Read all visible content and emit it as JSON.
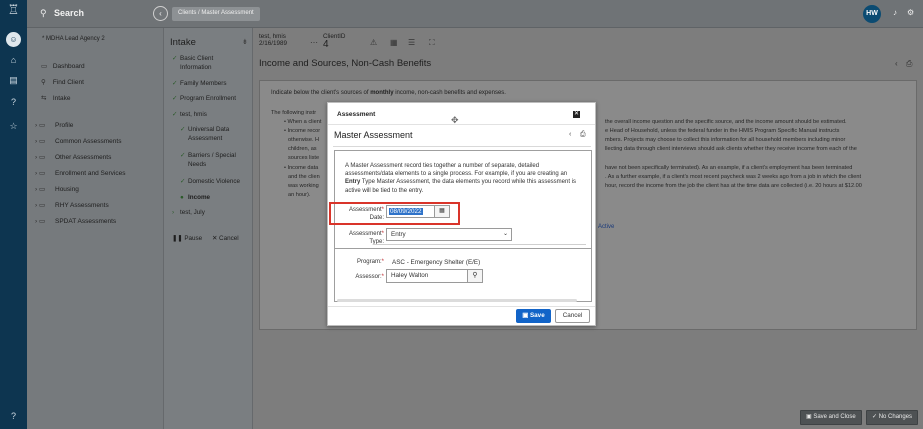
{
  "rail": {
    "logo": "♖",
    "avatar": "☺",
    "icons": [
      "⌂",
      "▤",
      "?",
      "☆"
    ],
    "help": "?"
  },
  "topbar": {
    "search_label": "Search",
    "breadcrumb": "Clients / Master Assessment",
    "user_initials": "HW",
    "bell": "🔔",
    "gear": "⚙"
  },
  "sidebar": {
    "agency": "* MDHA Lead Agency 2",
    "nav": [
      {
        "icon": "▭",
        "label": "Dashboard"
      },
      {
        "icon": "⚲",
        "label": "Find Client"
      },
      {
        "icon": "⇆",
        "label": "Intake"
      }
    ],
    "folders": [
      "Profile",
      "Common Assessments",
      "Other Assessments",
      "Enrollment and Services",
      "Housing",
      "RHY Assessments",
      "SPDAT Assessments"
    ]
  },
  "intake": {
    "title": "Intake",
    "steps": [
      {
        "label": "Basic Client",
        "label2": "Information",
        "check": "✓",
        "sub": false
      },
      {
        "label": "Family Members",
        "label2": "",
        "check": "✓",
        "sub": false
      },
      {
        "label": "Program Enrollment",
        "label2": "",
        "check": "✓",
        "sub": false
      },
      {
        "label": "test, hmis",
        "label2": "",
        "check": "✓",
        "sub": false
      },
      {
        "label": "Universal Data",
        "label2": "Assessment",
        "check": "✓",
        "sub": true
      },
      {
        "label": "Barriers / Special",
        "label2": "Needs",
        "check": "✓",
        "sub": true
      },
      {
        "label": "Domestic Violence",
        "label2": "",
        "check": "✓",
        "sub": true
      },
      {
        "label": "Income",
        "label2": "",
        "check": "●",
        "sub": true
      },
      {
        "label": "test, July",
        "label2": "",
        "check": "›",
        "sub": false
      }
    ],
    "pause": "Pause",
    "cancel": "Cancel"
  },
  "client": {
    "name": "test, hmis",
    "dob": "2/16/1989",
    "id_label": "ClientID",
    "id": "4"
  },
  "main": {
    "title": "Income and Sources, Non-Cash Benefits",
    "intro_pre": "Indicate below the client's sources of ",
    "intro_bold": "monthly",
    "intro_post": " income, non-cash benefits and expenses.",
    "bg_lines": [
      "The following instr",
      "• When a client",
      "• Income recor",
      "otherwise. H",
      "children, as",
      "sources liste",
      "• Income data",
      "and the clien",
      "was working",
      "an hour).",
      "the overall income question and the specific source, and the income amount should be estimated.",
      "e Head of Household, unless the federal funder in the HMIS Program Specific Manual instructs",
      "mbers. Projects may choose to collect this information for all household members including minor",
      "llecting data through client interviews should ask clients whether they receive income from each of the",
      "have not been specifically terminated). As an example, if a client's employment has been terminated",
      ". As a further example, if a client's most recent paycheck was 2 weeks ago from a job in which the client",
      "hour, record the income from the job the client has at the time data are collected (i.e. 20 hours at $12.00"
    ],
    "active": "Active",
    "save_close": "Save and Close",
    "no_changes": "No Changes"
  },
  "modal": {
    "header": "Assessment",
    "title": "Master Assessment",
    "desc_1": "A Master Assessment record ties together a number of separate, detailed assessments/data elements to a single process. For example, if you are creating an ",
    "desc_bold": "Entry",
    "desc_2": " Type Master Assessment, the data elements you record while this assessment is active will be tied to the entry.",
    "date_label_1": "Assessment",
    "date_label_2": "Date:",
    "date_value": "08/09/2022",
    "type_label_1": "Assessment",
    "type_label_2": "Type:",
    "type_value": "Entry",
    "program_label": "Program:",
    "program_value": "ASC - Emergency Shelter (E/E)",
    "assessor_label": "Assessor:",
    "assessor_value": "Haley Walton",
    "required_mark": "*",
    "save": "Save",
    "cancel": "Cancel"
  },
  "colors": {
    "primary": "#1264c8",
    "highlight": "#d9342a",
    "rail": "#0d3550"
  }
}
